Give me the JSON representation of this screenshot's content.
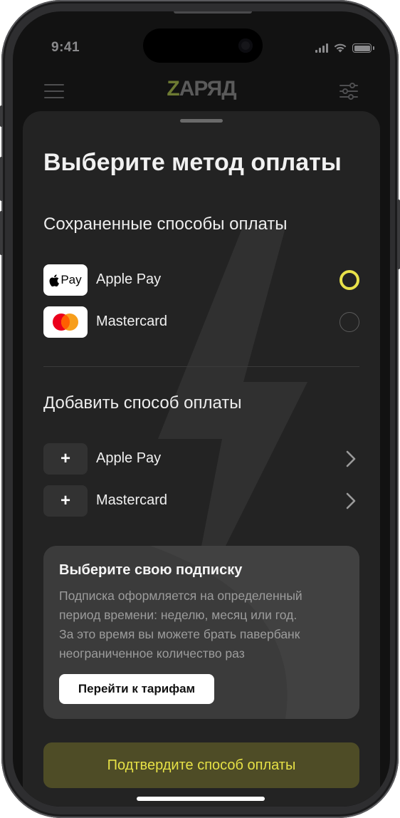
{
  "status_bar": {
    "time": "9:41"
  },
  "app_bar": {
    "logo_accent": "Z",
    "logo_rest": "АРЯД"
  },
  "sheet": {
    "title": "Выберите метод оплаты",
    "saved_section": {
      "heading": "Сохраненные способы оплаты",
      "methods": [
        {
          "label": "Apple Pay",
          "badge": "Pay",
          "selected": true
        },
        {
          "label": "Mastercard",
          "selected": false
        }
      ]
    },
    "add_section": {
      "heading": "Добавить способ оплаты",
      "methods": [
        {
          "label": "Apple Pay",
          "icon": "+"
        },
        {
          "label": "Mastercard",
          "icon": "+"
        }
      ]
    },
    "promo": {
      "title": "Выберите свою подписку",
      "text": "Подписка оформляется на определенный\nпериод времени: неделю, месяц или год.\nЗа это время вы можете брать павербанк\nнеограниченное количество раз",
      "button": "Перейти к тарифам"
    },
    "confirm_button": "Подтвердите способ оплаты"
  },
  "colors": {
    "accent": "#e9e24a",
    "logo_accent": "#6d7a32",
    "confirm_bg": "#4e4c26",
    "sheet_bg": "#232323"
  }
}
